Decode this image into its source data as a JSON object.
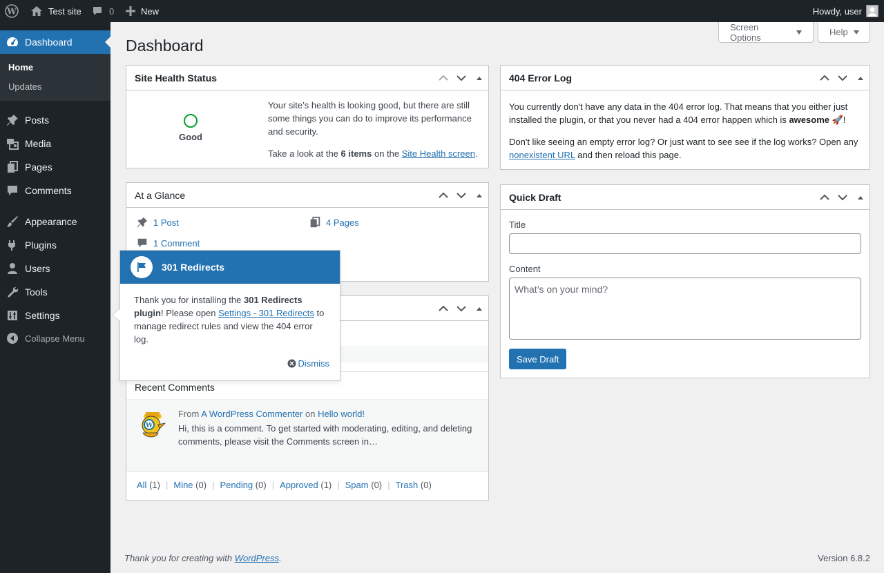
{
  "admin_bar": {
    "site_name": "Test site",
    "comments_count": "0",
    "new_label": "New",
    "howdy": "Howdy, user"
  },
  "sidebar": {
    "dashboard": "Dashboard",
    "sub_home": "Home",
    "sub_updates": "Updates",
    "items": [
      {
        "label": "Posts",
        "icon": "pushpin-icon"
      },
      {
        "label": "Media",
        "icon": "media-icon"
      },
      {
        "label": "Pages",
        "icon": "pages-icon"
      },
      {
        "label": "Comments",
        "icon": "comment-icon"
      },
      {
        "label": "Appearance",
        "icon": "brush-icon"
      },
      {
        "label": "Plugins",
        "icon": "plug-icon"
      },
      {
        "label": "Users",
        "icon": "user-icon"
      },
      {
        "label": "Tools",
        "icon": "wrench-icon"
      },
      {
        "label": "Settings",
        "icon": "sliders-icon"
      }
    ],
    "collapse": "Collapse Menu"
  },
  "page": {
    "title": "Dashboard",
    "screen_options": "Screen Options",
    "help": "Help"
  },
  "site_health": {
    "title": "Site Health Status",
    "status": "Good",
    "text1": "Your site’s health is looking good, but there are still some things you can do to improve its performance and security.",
    "text2_prefix": "Take a look at the",
    "text2_bold": "6 items",
    "text2_mid": "on the",
    "text2_link": "Site Health screen",
    "text2_suffix": "."
  },
  "at_a_glance": {
    "title": "At a Glance",
    "posts": "1 Post",
    "pages": "4 Pages",
    "comments": "1 Comment"
  },
  "pointer": {
    "title": "301 Redirects",
    "text_a": "Thank you for installing the",
    "text_bold": "301 Redirects plugin",
    "text_b": "! Please open",
    "text_link": "Settings - 301 Redirects",
    "text_c": "to manage redirect rules and view the 404 error log.",
    "dismiss": "Dismiss"
  },
  "activity": {
    "recent_comments": "Recent Comments",
    "from": "From",
    "author": "A WordPress Commenter",
    "on": "on",
    "post": "Hello world!",
    "excerpt": "Hi, this is a comment. To get started with moderating, editing, and deleting comments, please visit the Comments screen in…",
    "filters": [
      {
        "label": "All",
        "count": "(1)"
      },
      {
        "label": "Mine",
        "count": "(0)"
      },
      {
        "label": "Pending",
        "count": "(0)"
      },
      {
        "label": "Approved",
        "count": "(1)"
      },
      {
        "label": "Spam",
        "count": "(0)"
      },
      {
        "label": "Trash",
        "count": "(0)"
      }
    ]
  },
  "error_log": {
    "title": "404 Error Log",
    "p1": "You currently don't have any data in the 404 error log. That means that you either just installed the plugin, or that you never had a 404 error happen which is",
    "p1_bold": "awesome",
    "p1_end": "🚀!",
    "p2": "Don't like seeing an empty error log? Or just want to see see if the log works? Open any",
    "p2_link": "nonexistent URL",
    "p2_end": "and then reload this page."
  },
  "quick_draft": {
    "title": "Quick Draft",
    "title_label": "Title",
    "title_value": "",
    "content_label": "Content",
    "content_placeholder": "What’s on your mind?",
    "save": "Save Draft"
  },
  "footer": {
    "thanks": "Thank you for creating with",
    "wp_link": "WordPress",
    "period": ".",
    "version": "Version 6.8.2"
  },
  "colors": {
    "primary": "#2271b1",
    "admin_bg": "#1d2327",
    "health_good": "#00a32a"
  }
}
